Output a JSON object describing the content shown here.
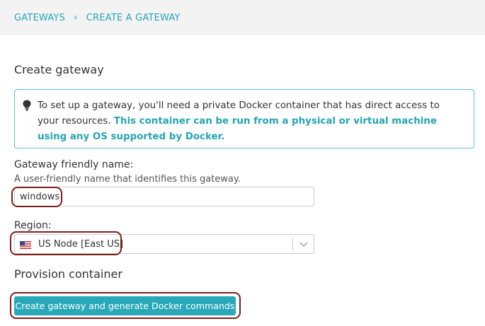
{
  "breadcrumb": {
    "items": [
      "GATEWAYS",
      "CREATE A GATEWAY"
    ],
    "separator": "›"
  },
  "page": {
    "title": "Create gateway"
  },
  "info": {
    "icon": "lightbulb-icon",
    "text_plain": "To set up a gateway, you'll need a private Docker container that has direct access to your resources. ",
    "text_highlight": "This container can be run from a physical or virtual machine using any OS supported by Docker."
  },
  "form": {
    "name_label": "Gateway friendly name:",
    "name_help": "A user-friendly name that identifies this gateway.",
    "name_value": "windows",
    "region_label": "Region:",
    "region_value": "US Node [East US]",
    "region_flag_icon": "us-flag-icon"
  },
  "provision": {
    "title": "Provision container",
    "button_label": "Create gateway and generate Docker commands"
  },
  "colors": {
    "accent": "#27a4b5",
    "button": "#29a9b8",
    "annotation_ring": "#7a1e1e",
    "header_bg": "#f3f3f3"
  }
}
